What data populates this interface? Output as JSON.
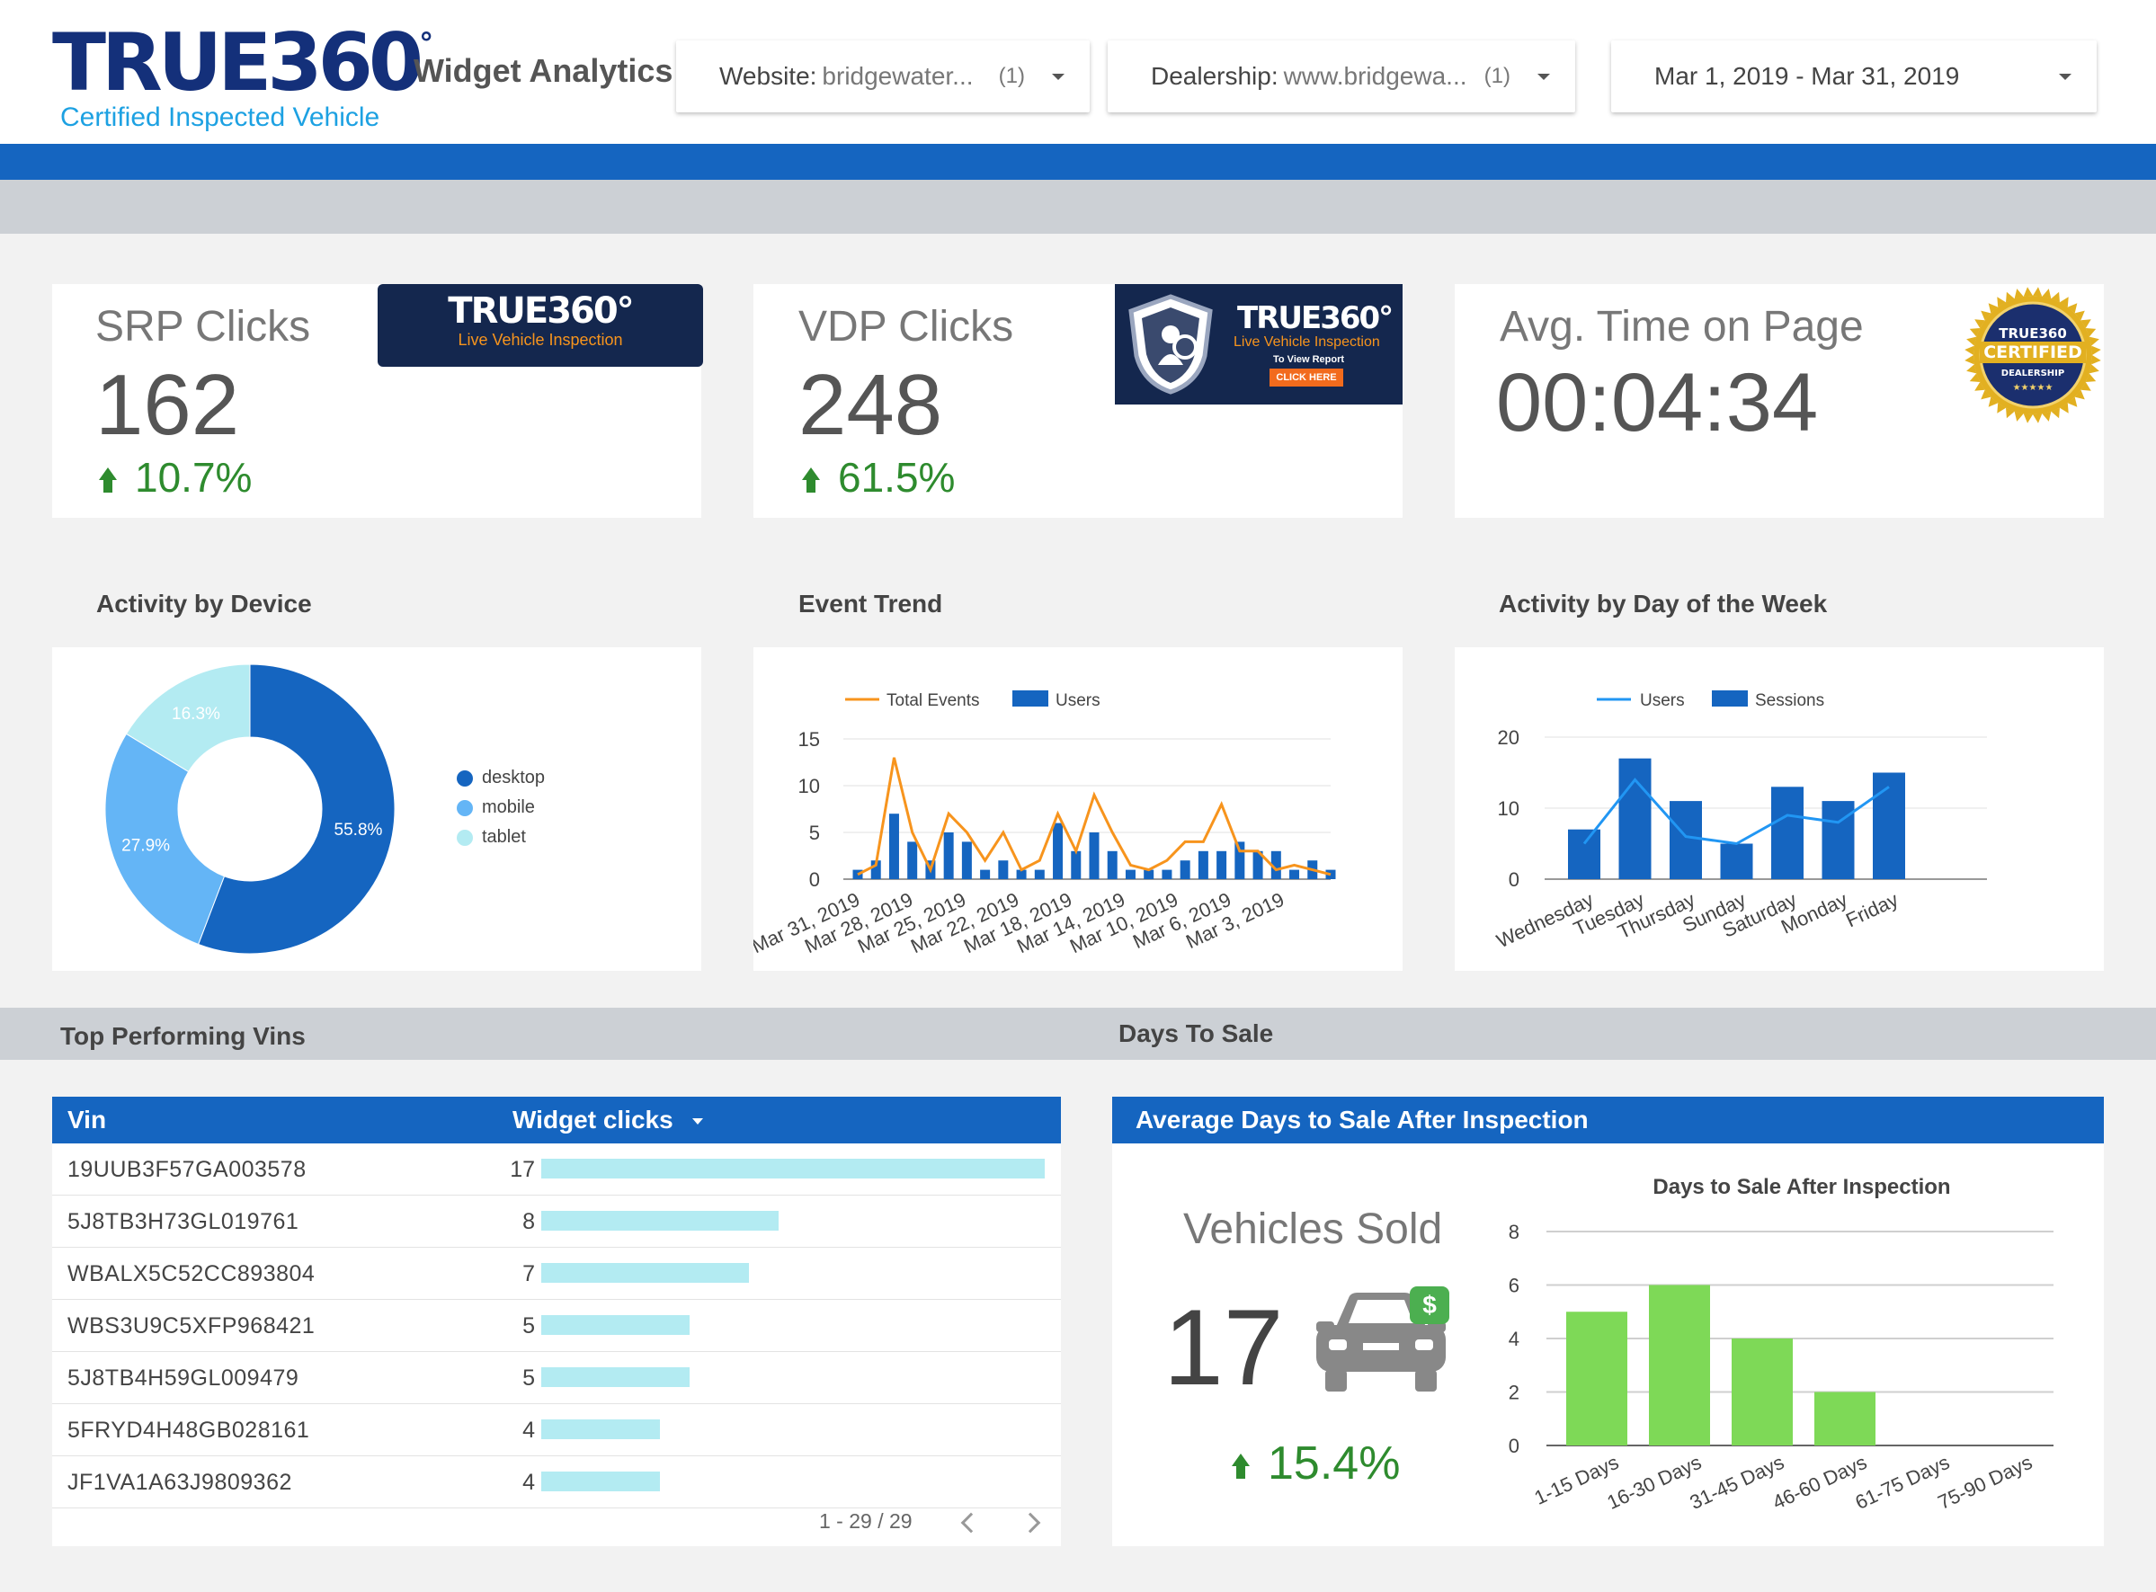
{
  "header": {
    "logo_main": "TRUE360",
    "logo_degree": "°",
    "logo_sub": "Certified Inspected Vehicle",
    "app_title": "Widget Analytics",
    "filters": [
      {
        "label": "Website:",
        "value": "bridgewater...",
        "count": "(1)"
      },
      {
        "label": "Dealership:",
        "value": "www.bridgewa...",
        "count": "(1)"
      }
    ],
    "date_range": "Mar 1, 2019 - Mar 31, 2019"
  },
  "kpis": {
    "srp": {
      "title": "SRP Clicks",
      "value": "162",
      "change": "10.7%"
    },
    "vdp": {
      "title": "VDP Clicks",
      "value": "248",
      "change": "61.5%"
    },
    "time": {
      "title": "Avg. Time on Page",
      "value": "00:04:34"
    }
  },
  "banners": {
    "srp": {
      "main": "TRUE360°",
      "sub": "Live Vehicle Inspection"
    },
    "vdp": {
      "main": "TRUE360°",
      "sub": "Live Vehicle Inspection",
      "small": "To View Report",
      "cta": "CLICK HERE"
    },
    "badge": {
      "top": "TRUE360",
      "mid": "CERTIFIED",
      "bottom": "DEALERSHIP",
      "stars": "★★★★★"
    }
  },
  "sections": {
    "device": "Activity by Device",
    "event_trend": "Event Trend",
    "day_of_week": "Activity by Day of the Week",
    "top_vins": "Top Performing Vins",
    "days_to_sale": "Days To Sale"
  },
  "colors": {
    "primary_blue": "#1565c0",
    "mobile": "#64b5f6",
    "tablet": "#b3ebf2",
    "orange": "#f7941d",
    "line_blue": "#2196f3",
    "green": "#7ed957",
    "positive": "#2e8b2e"
  },
  "chart_data": [
    {
      "type": "pie",
      "title": "Activity by Device",
      "series": [
        {
          "name": "desktop",
          "value": 55.8,
          "label": "55.8%"
        },
        {
          "name": "mobile",
          "value": 27.9,
          "label": "27.9%"
        },
        {
          "name": "tablet",
          "value": 16.3,
          "label": "16.3%"
        }
      ],
      "legend": "right"
    },
    {
      "type": "bar",
      "title": "Event Trend",
      "legend": [
        "Total Events",
        "Users"
      ],
      "ylim": [
        0,
        15
      ],
      "yticks": [
        "15",
        "10",
        "5",
        "0"
      ],
      "tick_labels": [
        "Mar 31, 2019",
        "Mar 28, 2019",
        "Mar 25, 2019",
        "Mar 22, 2019",
        "Mar 18, 2019",
        "Mar 14, 2019",
        "Mar 10, 2019",
        "Mar 6, 2019",
        "Mar 3, 2019"
      ],
      "series": [
        {
          "name": "Users",
          "kind": "bar",
          "values": [
            1,
            2,
            7,
            4,
            2,
            5,
            4,
            1,
            2,
            1,
            1,
            6,
            3,
            5,
            3,
            1,
            1,
            1,
            2,
            3,
            3,
            4,
            3,
            3,
            1,
            2,
            1
          ]
        },
        {
          "name": "Total Events",
          "kind": "line",
          "values": [
            0.5,
            1.5,
            13,
            5,
            1,
            7,
            5,
            2,
            5,
            1,
            2,
            7,
            3,
            9,
            5,
            1.5,
            1,
            2,
            4,
            4,
            8,
            3,
            3,
            1,
            1.5,
            1,
            0.5
          ]
        }
      ]
    },
    {
      "type": "bar",
      "title": "Activity by Day of the Week",
      "legend": [
        "Users",
        "Sessions"
      ],
      "ylim": [
        0,
        20
      ],
      "yticks": [
        "20",
        "10",
        "0"
      ],
      "categories": [
        "Wednesday",
        "Tuesday",
        "Thursday",
        "Sunday",
        "Saturday",
        "Monday",
        "Friday"
      ],
      "series": [
        {
          "name": "Sessions",
          "kind": "bar",
          "values": [
            7,
            17,
            11,
            5,
            13,
            11,
            15
          ]
        },
        {
          "name": "Users",
          "kind": "line",
          "values": [
            5,
            14,
            6,
            5,
            9,
            8,
            13
          ]
        }
      ]
    },
    {
      "type": "bar",
      "title": "Days to Sale After Inspection",
      "ylim": [
        0,
        8
      ],
      "yticks": [
        "8",
        "6",
        "4",
        "2",
        "0"
      ],
      "categories": [
        "1-15 Days",
        "16-30 Days",
        "31-45 Days",
        "46-60 Days",
        "61-75 Days",
        "75-90 Days"
      ],
      "values": [
        5,
        6,
        4,
        2,
        0,
        0
      ]
    }
  ],
  "table": {
    "col_vin": "Vin",
    "col_clicks": "Widget clicks",
    "max": 17,
    "rows": [
      {
        "vin": "19UUB3F57GA003578",
        "clicks": 17
      },
      {
        "vin": "5J8TB3H73GL019761",
        "clicks": 8
      },
      {
        "vin": "WBALX5C52CC893804",
        "clicks": 7
      },
      {
        "vin": "WBS3U9C5XFP968421",
        "clicks": 5
      },
      {
        "vin": "5J8TB4H59GL009479",
        "clicks": 5
      },
      {
        "vin": "5FRYD4H48GB028161",
        "clicks": 4
      },
      {
        "vin": "JF1VA1A63J9809362",
        "clicks": 4
      }
    ],
    "pager": "1 - 29 / 29"
  },
  "days_to_sale": {
    "header": "Average Days to Sale After Inspection",
    "sold_label": "Vehicles Sold",
    "sold_value": "17",
    "sold_change": "15.4%",
    "dollar": "$"
  }
}
